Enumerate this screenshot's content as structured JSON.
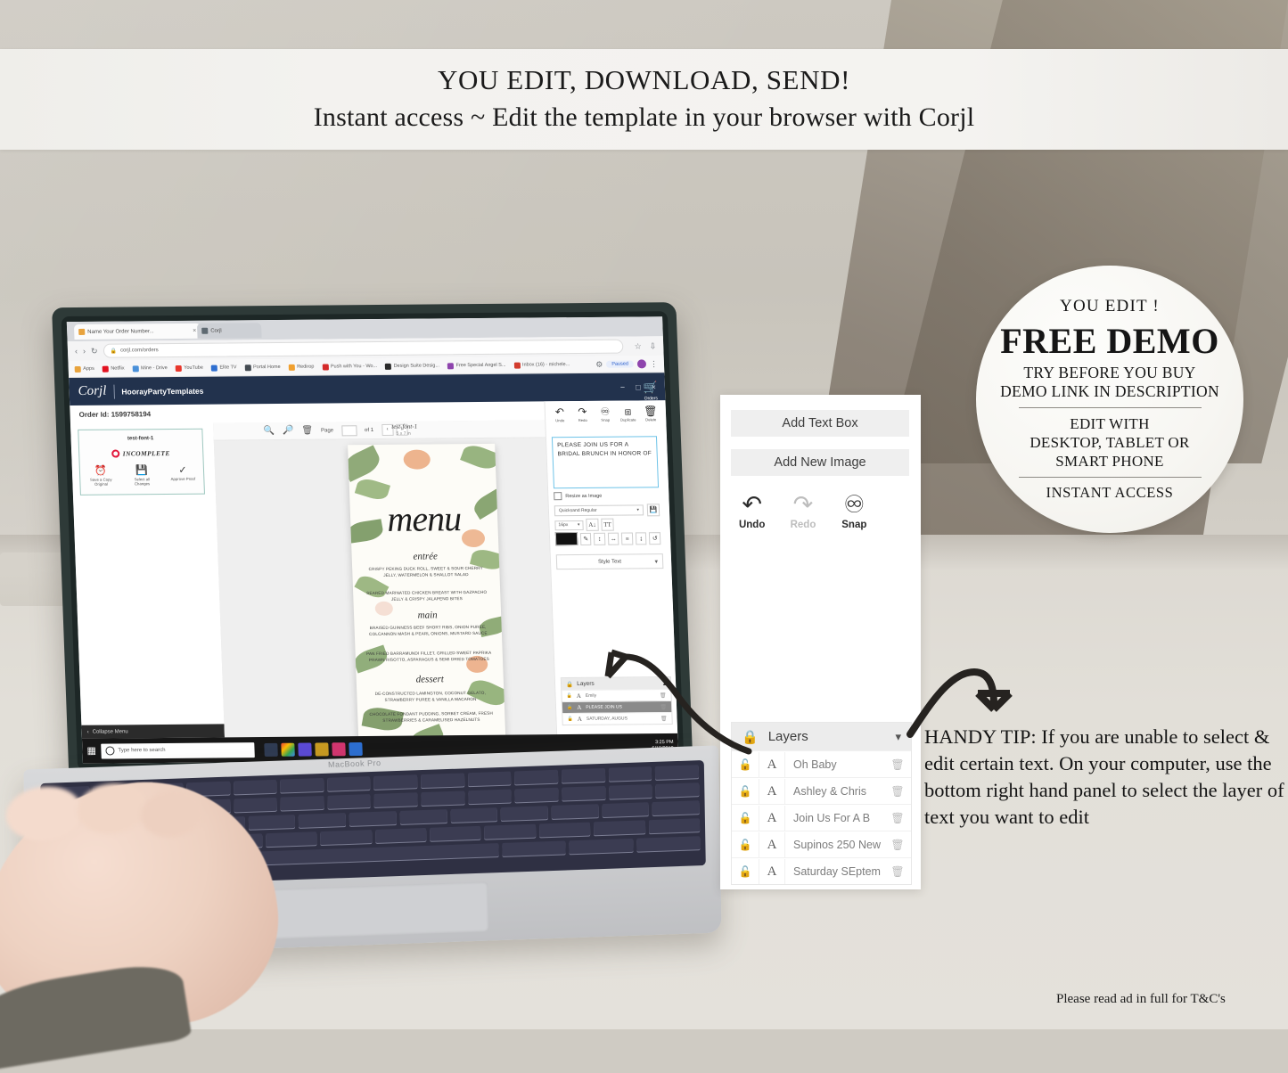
{
  "banner": {
    "line1": "YOU EDIT, DOWNLOAD, SEND!",
    "line2": "Instant access ~ Edit the template in your browser with Corjl"
  },
  "demo_badge": {
    "eyebrow": "YOU EDIT !",
    "title": "FREE DEMO",
    "sub1": "TRY BEFORE YOU BUY",
    "sub2": "DEMO LINK IN DESCRIPTION",
    "edit_with": "EDIT WITH",
    "devices1": "DESKTOP, TABLET OR",
    "devices2": "SMART PHONE",
    "instant": "INSTANT ACCESS"
  },
  "float_panel": {
    "add_text_box": "Add Text Box",
    "add_new_image": "Add New Image",
    "tools": [
      {
        "label": "Undo",
        "icon": "undo-icon",
        "disabled": false
      },
      {
        "label": "Redo",
        "icon": "redo-icon",
        "disabled": true
      },
      {
        "label": "Snap",
        "icon": "magnet-icon",
        "disabled": false
      }
    ],
    "layers_title": "Layers",
    "layers": [
      {
        "name": "Oh Baby"
      },
      {
        "name": "Ashley & Chris"
      },
      {
        "name": "Join Us For A B"
      },
      {
        "name": "Supinos 250 New"
      },
      {
        "name": "Saturday SEptem"
      }
    ]
  },
  "handy_tip": "HANDY TIP: If you are unable to select & edit certain text. On your computer, use the bottom right hand panel to select the layer of text you want to edit",
  "footer": {
    "terms": "Please read ad in full for T&C's"
  },
  "laptop": {
    "brand": "MacBook Pro",
    "browser": {
      "tabs": [
        {
          "title": "Name Your Order Number..."
        },
        {
          "title": "Corjl"
        }
      ],
      "url": "corjl.com/orders",
      "bookmarks": [
        {
          "label": "Apps",
          "color": "#e8a33d"
        },
        {
          "label": "Netflix",
          "color": "#e21221"
        },
        {
          "label": "Mine - Drive",
          "color": "#4a90d9"
        },
        {
          "label": "YouTube",
          "color": "#e8372c"
        },
        {
          "label": "Elite TV",
          "color": "#2f6fd0"
        },
        {
          "label": "Portal Home",
          "color": "#444b52"
        },
        {
          "label": "Redirop",
          "color": "#f0a030"
        },
        {
          "label": "Push with You - Wo...",
          "color": "#d42a2a"
        },
        {
          "label": "Design Suite Desig...",
          "color": "#2b2b2b"
        },
        {
          "label": "Free Special Angel S...",
          "color": "#8e44ad"
        },
        {
          "label": "Inbox (16) - michele...",
          "color": "#d23b2d"
        }
      ],
      "profile_pill": "Paused"
    },
    "app": {
      "logo": "Corjl",
      "shop": "HoorayPartyTemplates",
      "order_id": "Order Id: 1599758194",
      "collapse_menu": "Collapse Menu",
      "order_card": {
        "title": "test-font-1",
        "status": "INCOMPLETE",
        "actions": [
          {
            "label": "Save a Copy Original",
            "icon": "clock-back-icon"
          },
          {
            "label": "Select all Changes",
            "icon": "save-icon"
          },
          {
            "label": "Approve Proof",
            "icon": "check-icon"
          }
        ]
      },
      "canvas_toolbar": {
        "zoom_in": "zoom-in-icon",
        "zoom_out": "zoom-out-icon",
        "delete": "trash-icon",
        "page_label": "Page",
        "page_value": "1",
        "page_of": "of 1",
        "prev": "‹",
        "next": "›"
      },
      "doc_name": "test-font-1",
      "doc_size": "5 x 7 in",
      "menu_design": {
        "title": "menu",
        "sections": [
          {
            "heading": "entrée",
            "items": [
              "CRISPY PEKING DUCK ROLL, SWEET & SOUR CHERRY JELLY, WATERMELON & SHALLOT SALAD",
              "SEARED MARINATED CHICKEN BREAST WITH GAZPACHO JELLY & CRISPY JALAPENO BITES"
            ]
          },
          {
            "heading": "main",
            "items": [
              "BRAISED GUINNESS BEEF SHORT RIBS, ONION PUREE, COLCANNON MASH & PEARL ONIONS, MUSTARD SAUCE",
              "PAN FRIED BARRAMUNDI FILLET, GRILLED SWEET PAPRIKA PRAWN RISOTTO, ASPARAGUS & SEMI DRIED TOMATOES"
            ]
          },
          {
            "heading": "dessert",
            "items": [
              "DE-CONSTRUCTED LAMINGTON, COCONUT GELATO, STRAWBERRY PUREE & VANILLA MACARON",
              "CHOCOLATE FONDANT PUDDING, SORBET CREAM, FRESH STRAWBERRIES & CARAMELISED HAZELNUTS"
            ]
          }
        ]
      },
      "cart": {
        "label": "Orders",
        "icon": "cart-icon"
      },
      "edit_tools": [
        {
          "label": "Undo",
          "icon": "undo-icon"
        },
        {
          "label": "Redo",
          "icon": "redo-icon"
        },
        {
          "label": "Snap",
          "icon": "magnet-icon"
        },
        {
          "label": "Duplicate",
          "icon": "duplicate-icon"
        },
        {
          "label": "Delete",
          "icon": "trash-icon"
        }
      ],
      "text_value": "PLEASE JOIN US FOR A BRIDAL BRUNCH IN HONOR OF",
      "resize_label": "Resize as Image",
      "font_family": "Quicksand Regular",
      "font_size": "16px",
      "style_text": "Style Text",
      "layers_title": "Layers",
      "layers": [
        {
          "name": "Emily",
          "selected": false
        },
        {
          "name": "PLEASE JOIN US",
          "selected": true
        },
        {
          "name": "SATURDAY, AUGUS",
          "selected": false
        }
      ]
    },
    "taskbar": {
      "search_placeholder": "Type here to search",
      "time": "3:25 PM",
      "date": "6/10/2019"
    }
  },
  "colors": {
    "corjl_navy": "#22324d",
    "accent_teal": "#9ec7bf",
    "status_red": "#e2183c",
    "selection_blue": "#6ec3e8"
  }
}
